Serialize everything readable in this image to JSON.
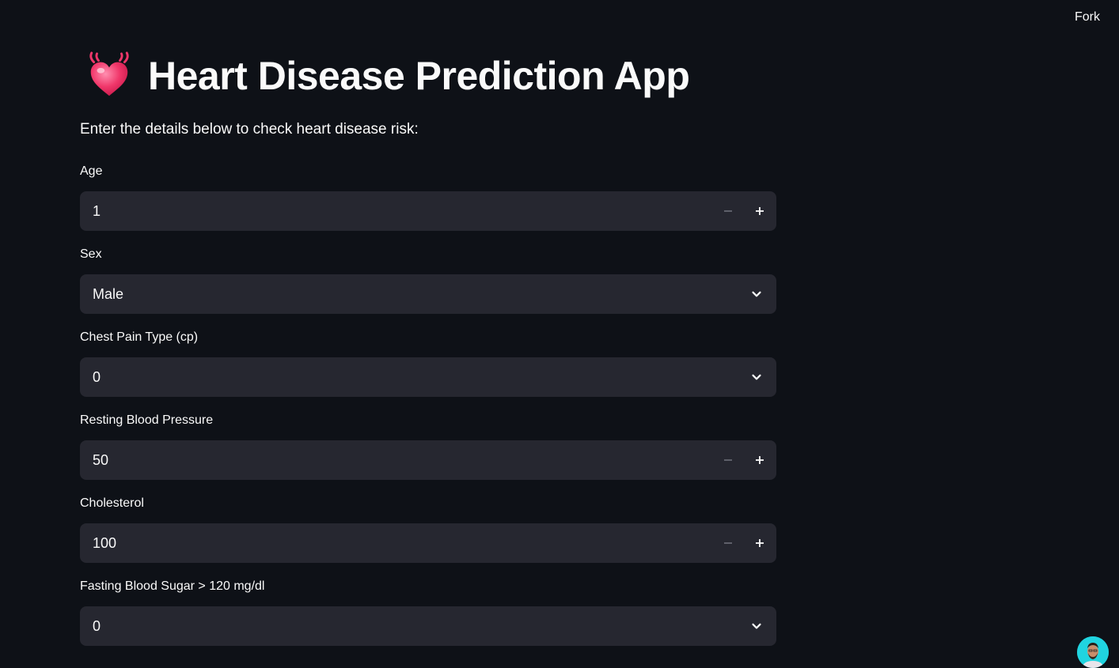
{
  "topbar": {
    "fork_label": "Fork"
  },
  "header": {
    "title": "Heart Disease Prediction App",
    "subtitle": "Enter the details below to check heart disease risk:"
  },
  "fields": {
    "age": {
      "label": "Age",
      "value": "1"
    },
    "sex": {
      "label": "Sex",
      "value": "Male"
    },
    "cp": {
      "label": "Chest Pain Type (cp)",
      "value": "0"
    },
    "trestbps": {
      "label": "Resting Blood Pressure",
      "value": "50"
    },
    "chol": {
      "label": "Cholesterol",
      "value": "100"
    },
    "fbs": {
      "label": "Fasting Blood Sugar > 120 mg/dl",
      "value": "0"
    }
  },
  "colors": {
    "background": "#0e1117",
    "input_bg": "#262730",
    "text": "#fafafa",
    "muted": "#6d6f78",
    "avatar_bg": "#20d4e0"
  },
  "icons": {
    "title_icon": "beating-heart-icon",
    "select_icon": "chevron-down-icon",
    "decrement_icon": "minus-icon",
    "increment_icon": "plus-icon"
  }
}
